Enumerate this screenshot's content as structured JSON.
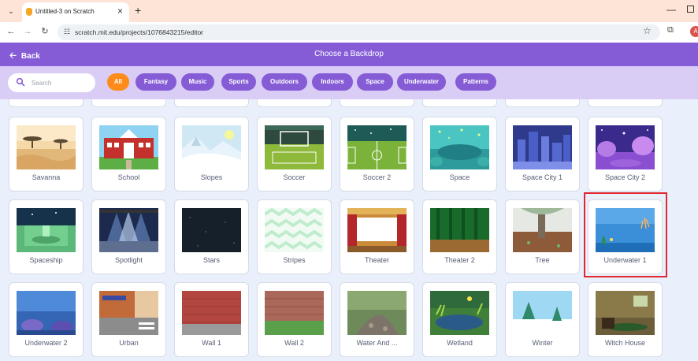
{
  "browser": {
    "tab_title": "Untitled-3 on Scratch",
    "url": "scratch.mit.edu/projects/1076843215/editor",
    "profile_initial": "A"
  },
  "header": {
    "back_label": "Back",
    "title": "Choose a Backdrop"
  },
  "search": {
    "placeholder": "Search"
  },
  "categories": [
    {
      "label": "All",
      "active": true
    },
    {
      "label": "Fantasy",
      "active": false
    },
    {
      "label": "Music",
      "active": false
    },
    {
      "label": "Sports",
      "active": false
    },
    {
      "label": "Outdoors",
      "active": false
    },
    {
      "label": "Indoors",
      "active": false
    },
    {
      "label": "Space",
      "active": false
    },
    {
      "label": "Underwater",
      "active": false
    },
    {
      "label": "Patterns",
      "active": false
    }
  ],
  "backdrops": [
    {
      "name": "Savanna",
      "thumb": "savanna"
    },
    {
      "name": "School",
      "thumb": "school"
    },
    {
      "name": "Slopes",
      "thumb": "slopes"
    },
    {
      "name": "Soccer",
      "thumb": "soccer"
    },
    {
      "name": "Soccer 2",
      "thumb": "soccer2"
    },
    {
      "name": "Space",
      "thumb": "space"
    },
    {
      "name": "Space City 1",
      "thumb": "spacecity1"
    },
    {
      "name": "Space City 2",
      "thumb": "spacecity2"
    },
    {
      "name": "Spaceship",
      "thumb": "spaceship"
    },
    {
      "name": "Spotlight",
      "thumb": "spotlight"
    },
    {
      "name": "Stars",
      "thumb": "stars"
    },
    {
      "name": "Stripes",
      "thumb": "stripes"
    },
    {
      "name": "Theater",
      "thumb": "theater"
    },
    {
      "name": "Theater 2",
      "thumb": "theater2"
    },
    {
      "name": "Tree",
      "thumb": "tree"
    },
    {
      "name": "Underwater 1",
      "thumb": "underwater1",
      "highlighted": true
    },
    {
      "name": "Underwater 2",
      "thumb": "underwater2"
    },
    {
      "name": "Urban",
      "thumb": "urban"
    },
    {
      "name": "Wall 1",
      "thumb": "wall1"
    },
    {
      "name": "Wall 2",
      "thumb": "wall2"
    },
    {
      "name": "Water And ...",
      "thumb": "waterand"
    },
    {
      "name": "Wetland",
      "thumb": "wetland"
    },
    {
      "name": "Winter",
      "thumb": "winter"
    },
    {
      "name": "Witch House",
      "thumb": "witchhouse"
    }
  ],
  "colors": {
    "header_purple": "#855cd6",
    "active_chip": "#ff8c1a",
    "highlight_red": "#e0282e"
  }
}
